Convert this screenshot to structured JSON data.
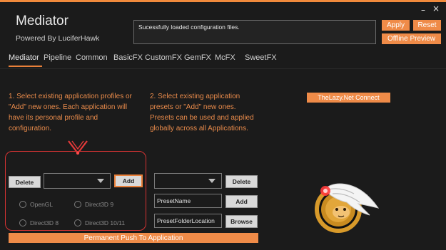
{
  "window": {
    "minimize_label": "–",
    "close_label": "×"
  },
  "header": {
    "title": "Mediator",
    "subtitle": "Powered By LuciferHawk"
  },
  "status": {
    "message": "Sucessfully loaded configuration files."
  },
  "actions": {
    "apply": "Apply",
    "reset": "Reset",
    "offline_preview": "Offline Preview"
  },
  "tabs": [
    {
      "label": "Mediator",
      "active": true
    },
    {
      "label": "Pipeline"
    },
    {
      "label": "Common"
    },
    {
      "label": "BasicFX"
    },
    {
      "label": "CustomFX"
    },
    {
      "label": "GemFX"
    },
    {
      "label": "McFX"
    },
    {
      "label": "SweetFX"
    }
  ],
  "instructions": {
    "left": "1. Select existing application profiles or \"Add\" new ones. Each application will have its personal profile and configuration.",
    "right": "2. Select existing application presets or \"Add\" new ones. Presets can be used and applied globally across all Applications."
  },
  "connect_button": "TheLazy.Net Connect",
  "profiles": {
    "delete_label": "Delete",
    "add_label": "Add",
    "selected": "",
    "apis": [
      {
        "label": "OpenGL"
      },
      {
        "label": "Direct3D 9"
      },
      {
        "label": "Direct3D 8"
      },
      {
        "label": "Direct3D 10/11"
      }
    ]
  },
  "presets": {
    "selected": "",
    "delete_label": "Delete",
    "name_value": "PresetName",
    "add_label": "Add",
    "folder_value": "PresetFolderLocation",
    "browse_label": "Browse"
  },
  "push_button": "Permanent Push To Application",
  "colors": {
    "accent": "#ef8b48",
    "background": "#1b1b1b",
    "highlight": "#d63333"
  }
}
